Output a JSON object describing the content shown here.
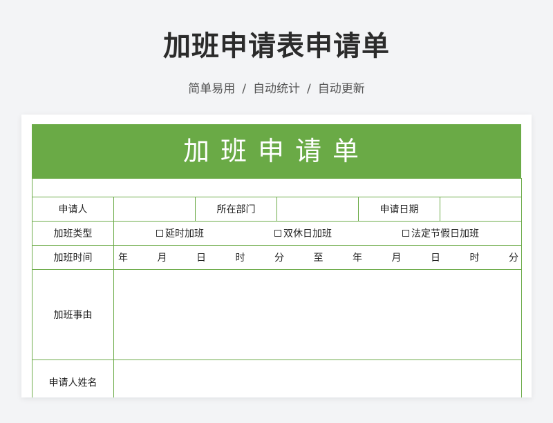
{
  "page": {
    "title": "加班申请表申请单",
    "subtitle": [
      "简单易用",
      "自动统计",
      "自动更新"
    ],
    "separator": "/"
  },
  "form": {
    "header": "加班申请单",
    "applicant_label": "申请人",
    "department_label": "所在部门",
    "date_label": "申请日期",
    "type_label": "加班类型",
    "type_options": [
      "延时加班",
      "双休日加班",
      "法定节假日加班"
    ],
    "time_label": "加班时间",
    "time_units": [
      "年",
      "月",
      "日",
      "时",
      "分",
      "至",
      "年",
      "月",
      "日",
      "时",
      "分"
    ],
    "reason_label": "加班事由",
    "signature_label": "申请人姓名"
  },
  "colors": {
    "accent": "#6aaa46"
  }
}
